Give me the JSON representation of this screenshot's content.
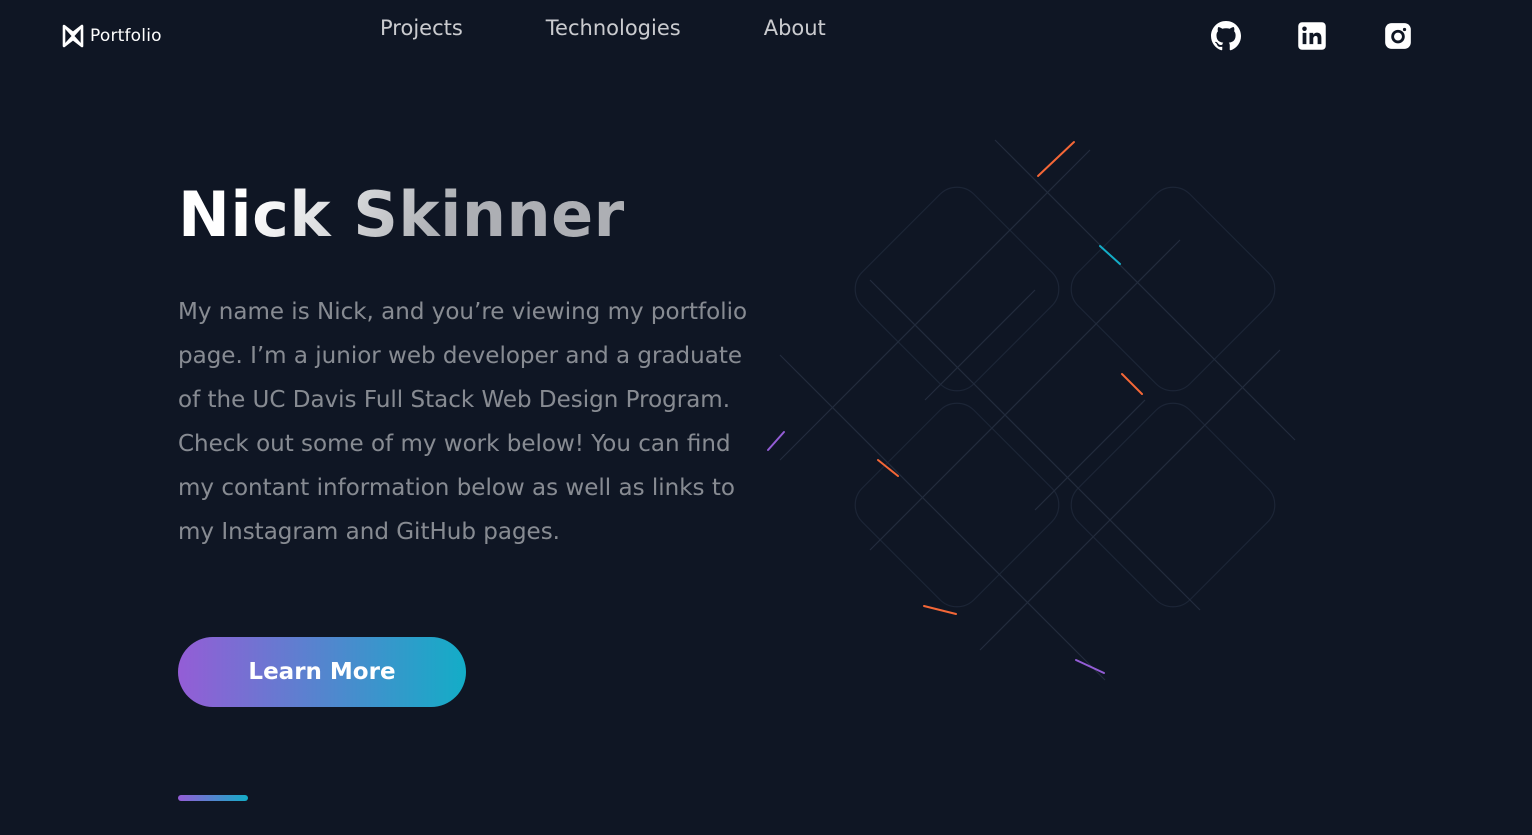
{
  "header": {
    "logo_text": "Portfolio",
    "nav": [
      {
        "label": "Projects"
      },
      {
        "label": "Technologies"
      },
      {
        "label": "About"
      }
    ],
    "socials": [
      {
        "icon": "github-icon"
      },
      {
        "icon": "linkedin-icon"
      },
      {
        "icon": "instagram-icon"
      }
    ]
  },
  "hero": {
    "title": "Nick Skinner",
    "description": "My name is Nick, and you’re viewing my portfolio page. I’m a junior web developer and a graduate of the UC Davis Full Stack Web Design Program. Check out some of my work below! You can find my contant information below as well as links to my Instagram and GitHub pages.",
    "button_label": "Learn More"
  },
  "colors": {
    "background": "#0f1624",
    "gradient_start": "#945dd6",
    "gradient_mid": "#6978d1",
    "gradient_end": "#13adc7"
  }
}
